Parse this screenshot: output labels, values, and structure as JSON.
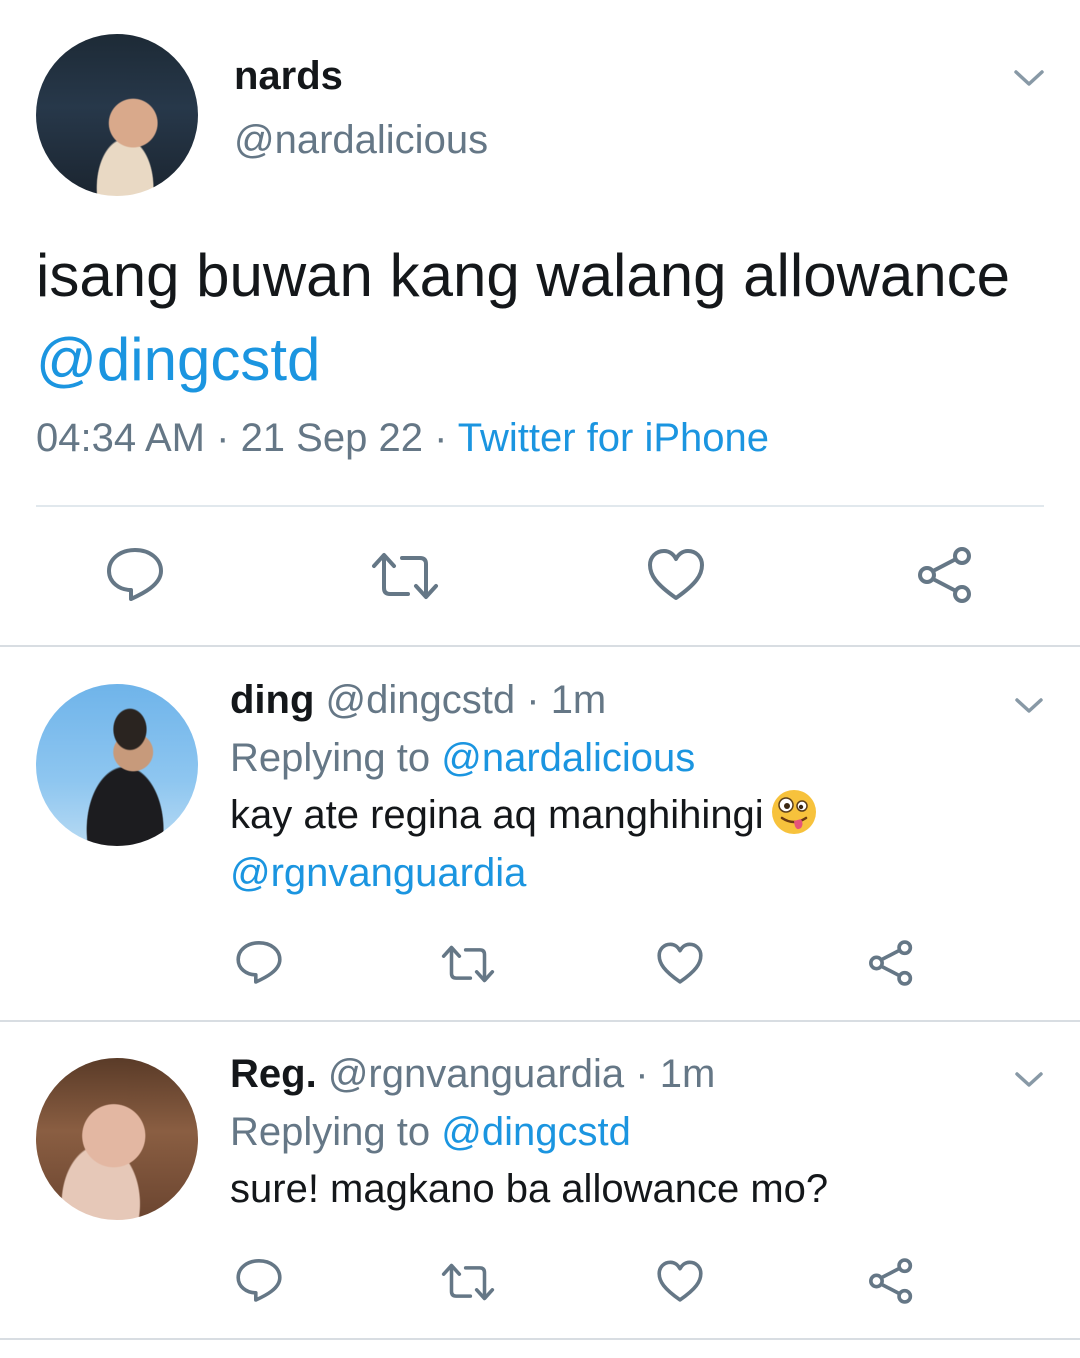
{
  "main_tweet": {
    "author_name": "nards",
    "author_handle": "@nardalicious",
    "text_plain": "isang buwan kang walang allowance ",
    "text_mention": "@dingcstd",
    "time": "04:34 AM",
    "separator": " · ",
    "date": "21 Sep 22",
    "source": "Twitter for iPhone",
    "icons": [
      "reply-icon",
      "retweet-icon",
      "like-icon",
      "share-icon",
      "chevron-down-icon"
    ]
  },
  "replies": [
    {
      "author_name": "ding",
      "author_handle": "@dingcstd",
      "time": "1m",
      "replying_prefix": "Replying to ",
      "replying_to": "@nardalicious",
      "text_plain": "kay ate regina aq manghihingi",
      "emoji": "zany-face-emoji",
      "text_mention": "@rgnvanguardia"
    },
    {
      "author_name": "Reg.",
      "author_handle": "@rgnvanguardia",
      "time": "1m",
      "replying_prefix": "Replying to ",
      "replying_to": "@dingcstd",
      "text_plain": "sure! magkano ba allowance mo?"
    }
  ],
  "colors": {
    "text": "#14171a",
    "secondary": "#657786",
    "link": "#1b95e0",
    "divider": "#e1e8ed",
    "icon": "#657786"
  }
}
